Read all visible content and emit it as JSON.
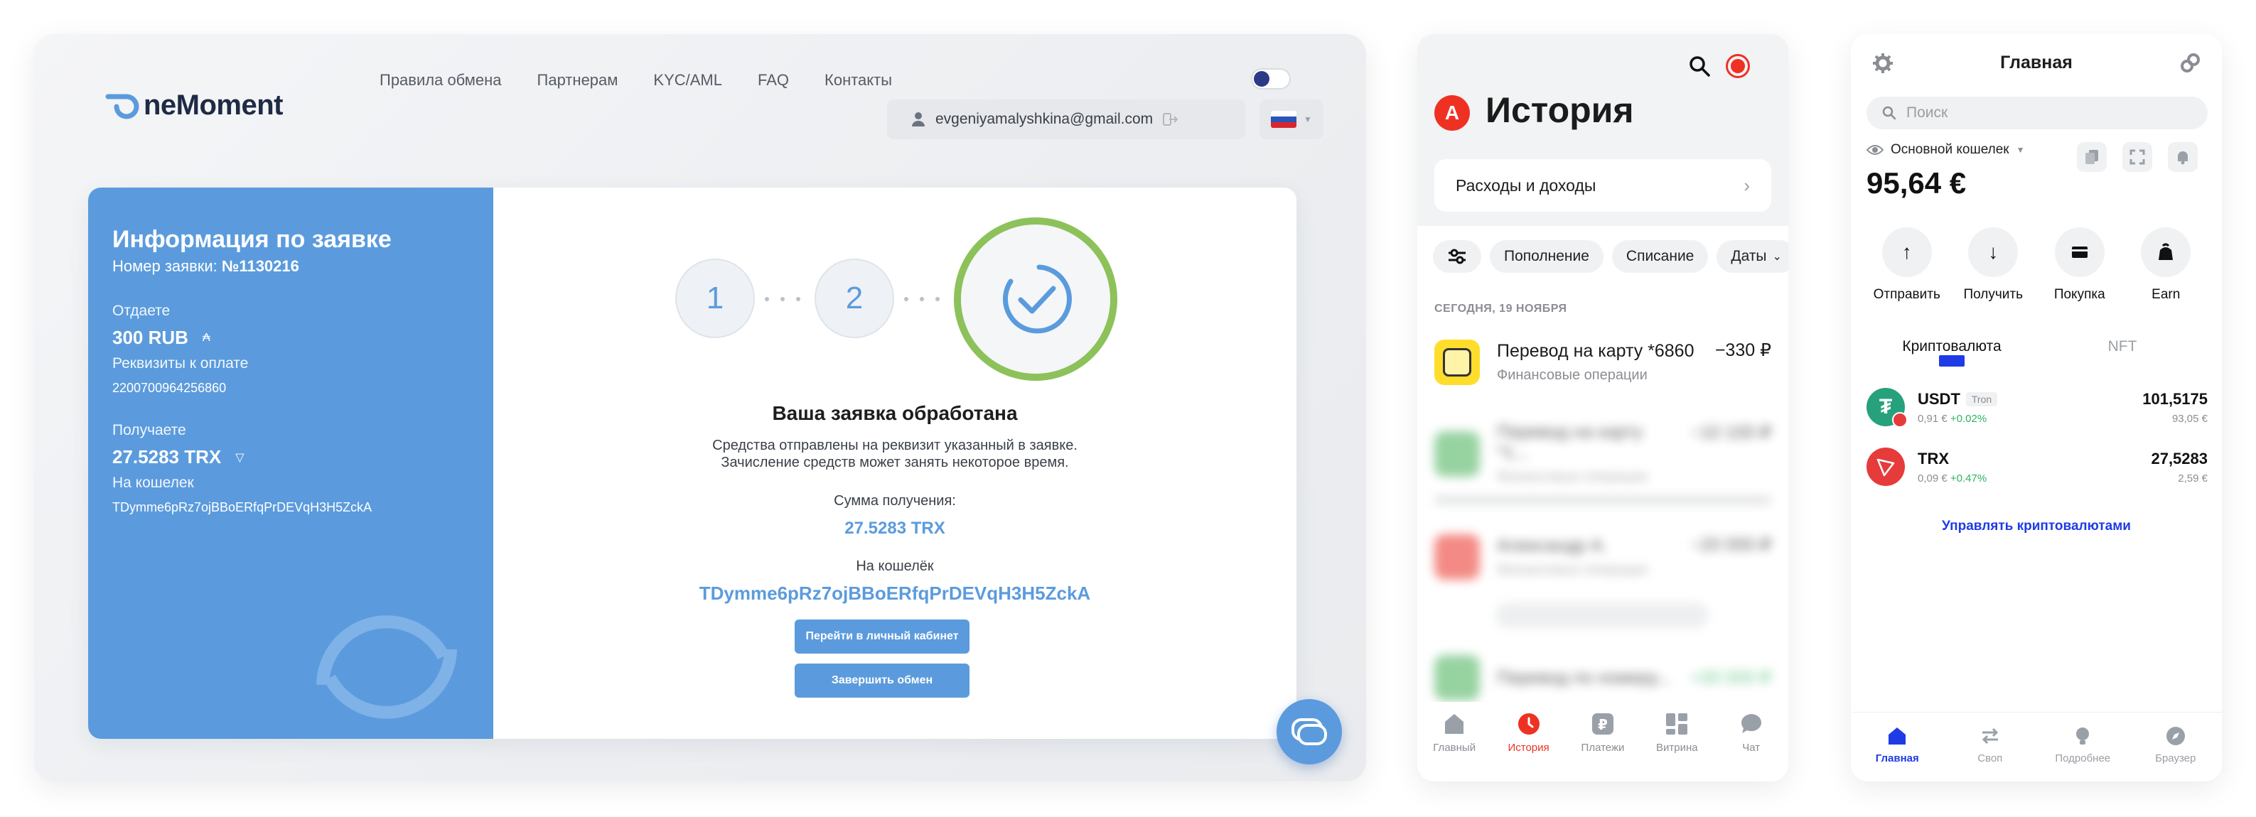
{
  "exchange": {
    "brand": "neMoment",
    "nav": [
      "Правила обмена",
      "Партнерам",
      "KYC/AML",
      "FAQ",
      "Контакты"
    ],
    "user_email": "evgeniyamalyshkina@gmail.com",
    "order": {
      "title": "Информация по заявке",
      "number_label": "Номер заявки:",
      "number": "№1130216",
      "give_label": "Отдаете",
      "give_value": "300 RUB",
      "requisites_label": "Реквизиты к оплате",
      "requisites_value": "2200700964256860",
      "receive_label": "Получаете",
      "receive_value": "27.5283 TRX",
      "wallet_label": "На кошелек",
      "wallet_value": "TDymme6pRz7ojBBoERfqPrDEVqH3H5ZckA"
    },
    "steps": [
      "1",
      "2"
    ],
    "status_title": "Ваша заявка обработана",
    "status_text_1": "Средства отправлены на реквизит указанный в заявке.",
    "status_text_2": "Зачисление средств может занять некоторое время.",
    "amount_label": "Сумма получения:",
    "amount_value": "27.5283 TRX",
    "wallet_label": "На кошелёк",
    "wallet_value": "TDymme6pRz7ojBBoERfqPrDEVqH3H5ZckA",
    "btn_cabinet": "Перейти в личный кабинет",
    "btn_finish": "Завершить обмен",
    "colors": {
      "accent": "#5b9bdd",
      "success": "#8dc15a"
    }
  },
  "bank": {
    "title": "История",
    "logo_letter": "А",
    "income_expense": "Расходы и доходы",
    "filters": [
      "Пополнение",
      "Списание",
      "Даты"
    ],
    "date_header": "СЕГОДНЯ, 19 НОЯБРЯ",
    "transaction": {
      "name": "Перевод на карту *6860",
      "category": "Финансовые операции",
      "amount": "−330 ₽"
    },
    "blurred": [
      {
        "name": "Перевод на карту *1...",
        "amount": "−10 100 ₽",
        "category": "Финансовые операции"
      },
      {
        "name": "Александр А.",
        "amount": "−20 000 ₽",
        "category": "Финансовые операции"
      },
      {
        "name": "Перевод по номеру...",
        "amount": "+30 000 ₽",
        "category": "Финансовые операции"
      }
    ],
    "tabs": [
      "Главный",
      "История",
      "Платежи",
      "Витрина",
      "Чат"
    ],
    "colors": {
      "brand": "#ef3124"
    }
  },
  "wallet": {
    "title": "Главная",
    "search_placeholder": "Поиск",
    "wallet_name": "Основной кошелек",
    "balance": "95,64 €",
    "actions": [
      "Отправить",
      "Получить",
      "Покупка",
      "Earn"
    ],
    "tabs": [
      "Криптовалюта",
      "NFT"
    ],
    "coins": [
      {
        "symbol": "USDT",
        "network": "Tron",
        "price": "0,91 €",
        "change": "+0.02%",
        "amount": "101,5175",
        "fiat": "93,05 €"
      },
      {
        "symbol": "TRX",
        "network": "",
        "price": "0,09 €",
        "change": "+0.47%",
        "amount": "27,5283",
        "fiat": "2,59 €"
      }
    ],
    "manage": "Управлять криптовалютами",
    "bottom_tabs": [
      "Главная",
      "Своп",
      "Подробнее",
      "Браузер"
    ],
    "colors": {
      "accent": "#1e3be6",
      "positive": "#2eb35e"
    }
  }
}
